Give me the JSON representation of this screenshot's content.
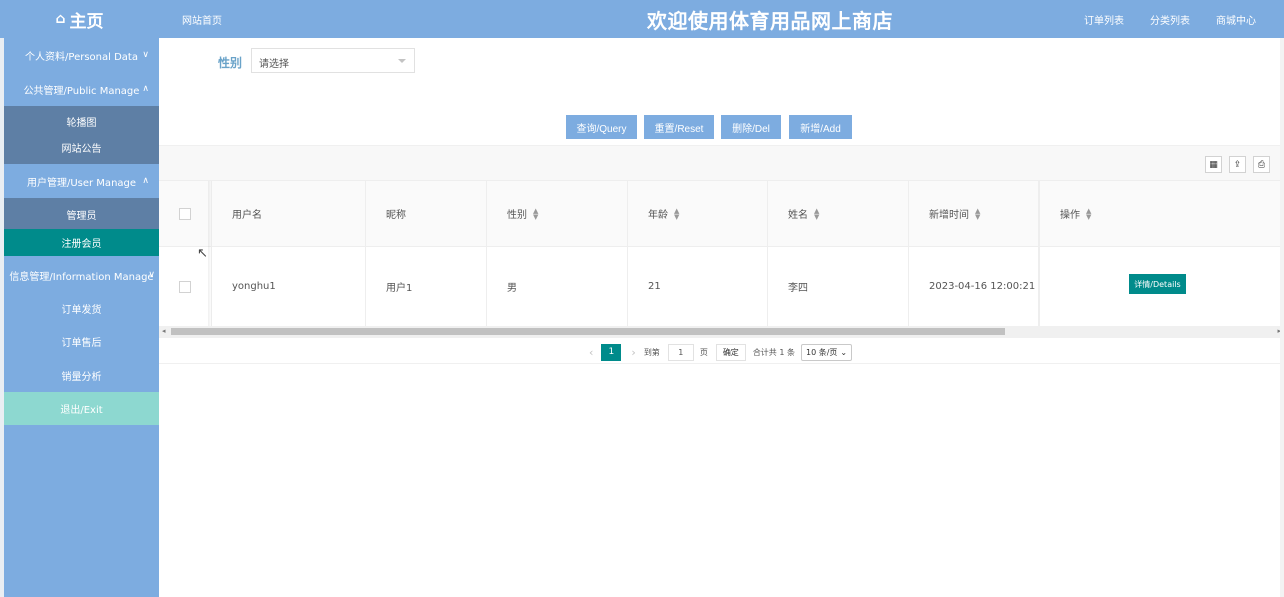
{
  "header": {
    "brand": "主页",
    "site_home": "网站首页",
    "title": "欢迎使用体育用品网上商店",
    "links": [
      "订单列表",
      "分类列表",
      "商城中心"
    ]
  },
  "sidebar": {
    "items": [
      {
        "label": "个人资料/Personal Data",
        "arrow": "∨"
      },
      {
        "label": "公共管理/Public Manage",
        "arrow": "∧"
      },
      {
        "label": "轮播图"
      },
      {
        "label": "网站公告"
      },
      {
        "label": "用户管理/User Manage",
        "arrow": "∧"
      },
      {
        "label": "管理员"
      },
      {
        "label": "注册会员"
      },
      {
        "label": "信息管理/Information Manage",
        "arrow": "∨"
      },
      {
        "label": "订单发货"
      },
      {
        "label": "订单售后"
      },
      {
        "label": "销量分析"
      },
      {
        "label": "退出/Exit"
      }
    ]
  },
  "filter": {
    "label": "性别",
    "placeholder": "请选择"
  },
  "buttons": {
    "query": "查询/Query",
    "reset": "重置/Reset",
    "delete": "删除/Del",
    "add": "新增/Add"
  },
  "table": {
    "headers": [
      "用户名",
      "昵称",
      "性别",
      "年龄",
      "姓名",
      "新增时间",
      "操作"
    ],
    "rows": [
      {
        "username": "yonghu1",
        "nickname": "用户1",
        "gender": "男",
        "age": "21",
        "name": "李四",
        "created": "2023-04-16 12:00:21",
        "action": "详情/Details"
      }
    ]
  },
  "pager": {
    "current": "1",
    "goto_label": "到第",
    "goto_value": "1",
    "page_unit": "页",
    "confirm": "确定",
    "total": "合计共 1 条",
    "page_size": "10 条/页"
  },
  "colors": {
    "primary": "#7dace0",
    "active": "#008b8b",
    "exit": "#8dd8d0",
    "submenu": "#5e7fa5"
  }
}
